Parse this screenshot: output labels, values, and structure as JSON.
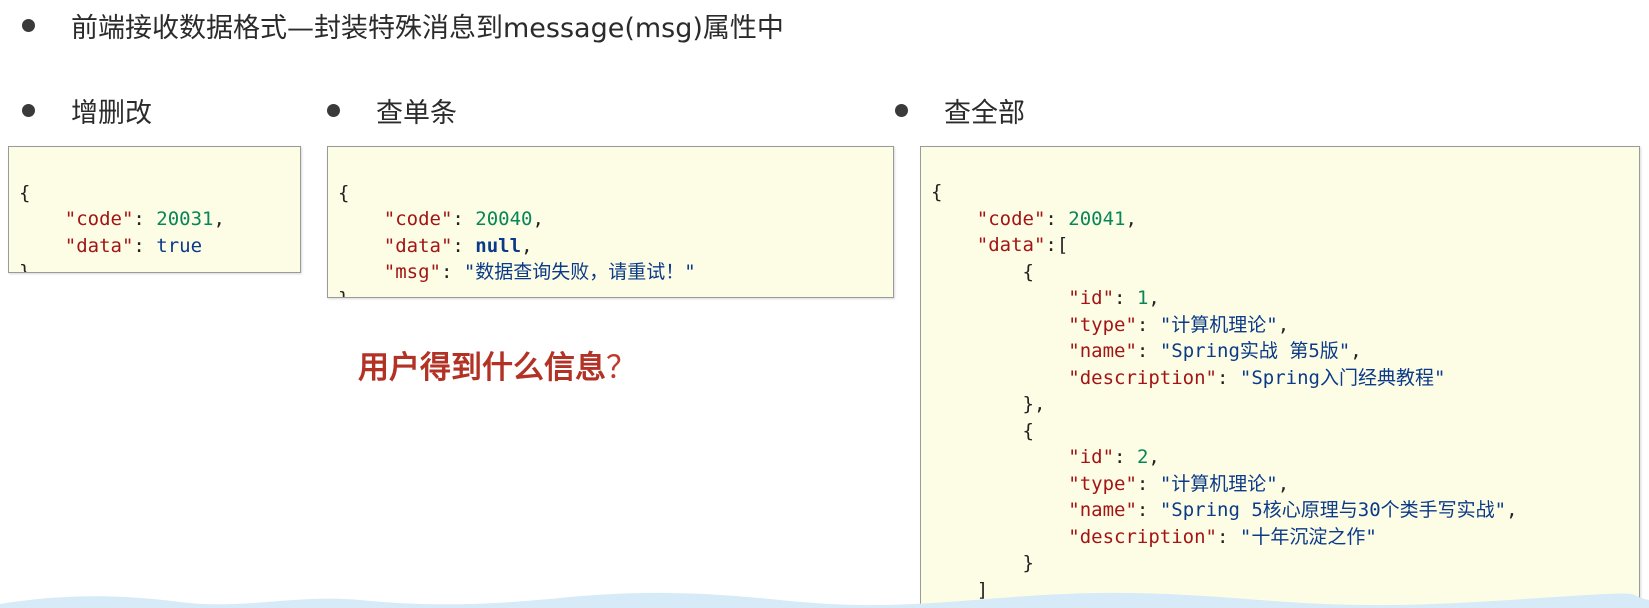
{
  "heading": "前端接收数据格式—封装特殊消息到message(msg)属性中",
  "sections": {
    "crud": {
      "title": "增删改"
    },
    "single": {
      "title": "查单条"
    },
    "all": {
      "title": "查全部"
    }
  },
  "crud_code": {
    "open": "{",
    "code_key": "\"code\"",
    "code_val": "20031",
    "data_key": "\"data\"",
    "data_val": "true",
    "close": "}"
  },
  "single_code": {
    "open": "{",
    "code_key": "\"code\"",
    "code_val": "20040",
    "data_key": "\"data\"",
    "data_val": "null",
    "msg_key": "\"msg\"",
    "msg_val": "\"数据查询失败，请重试！\"",
    "close": "}"
  },
  "all_code": {
    "open": "{",
    "code_key": "\"code\"",
    "code_val": "20041",
    "data_key": "\"data\"",
    "items": [
      {
        "id_val": "1",
        "type_val": "\"计算机理论\"",
        "name_val": "\"Spring实战 第5版\"",
        "desc_val": "\"Spring入门经典教程\""
      },
      {
        "id_val": "2",
        "type_val": "\"计算机理论\"",
        "name_val": "\"Spring 5核心原理与30个类手写实战\"",
        "desc_val": "\"十年沉淀之作\""
      }
    ],
    "id_key": "\"id\"",
    "type_key": "\"type\"",
    "name_key": "\"name\"",
    "desc_key": "\"description\"",
    "close": "}"
  },
  "question": {
    "text": "用户得到什么信息",
    "mark": "？"
  },
  "colors": {
    "code_bg": "#fdfde6",
    "key": "#a31515",
    "number": "#098658",
    "keyword": "#0b3a88",
    "question": "#b23326"
  }
}
